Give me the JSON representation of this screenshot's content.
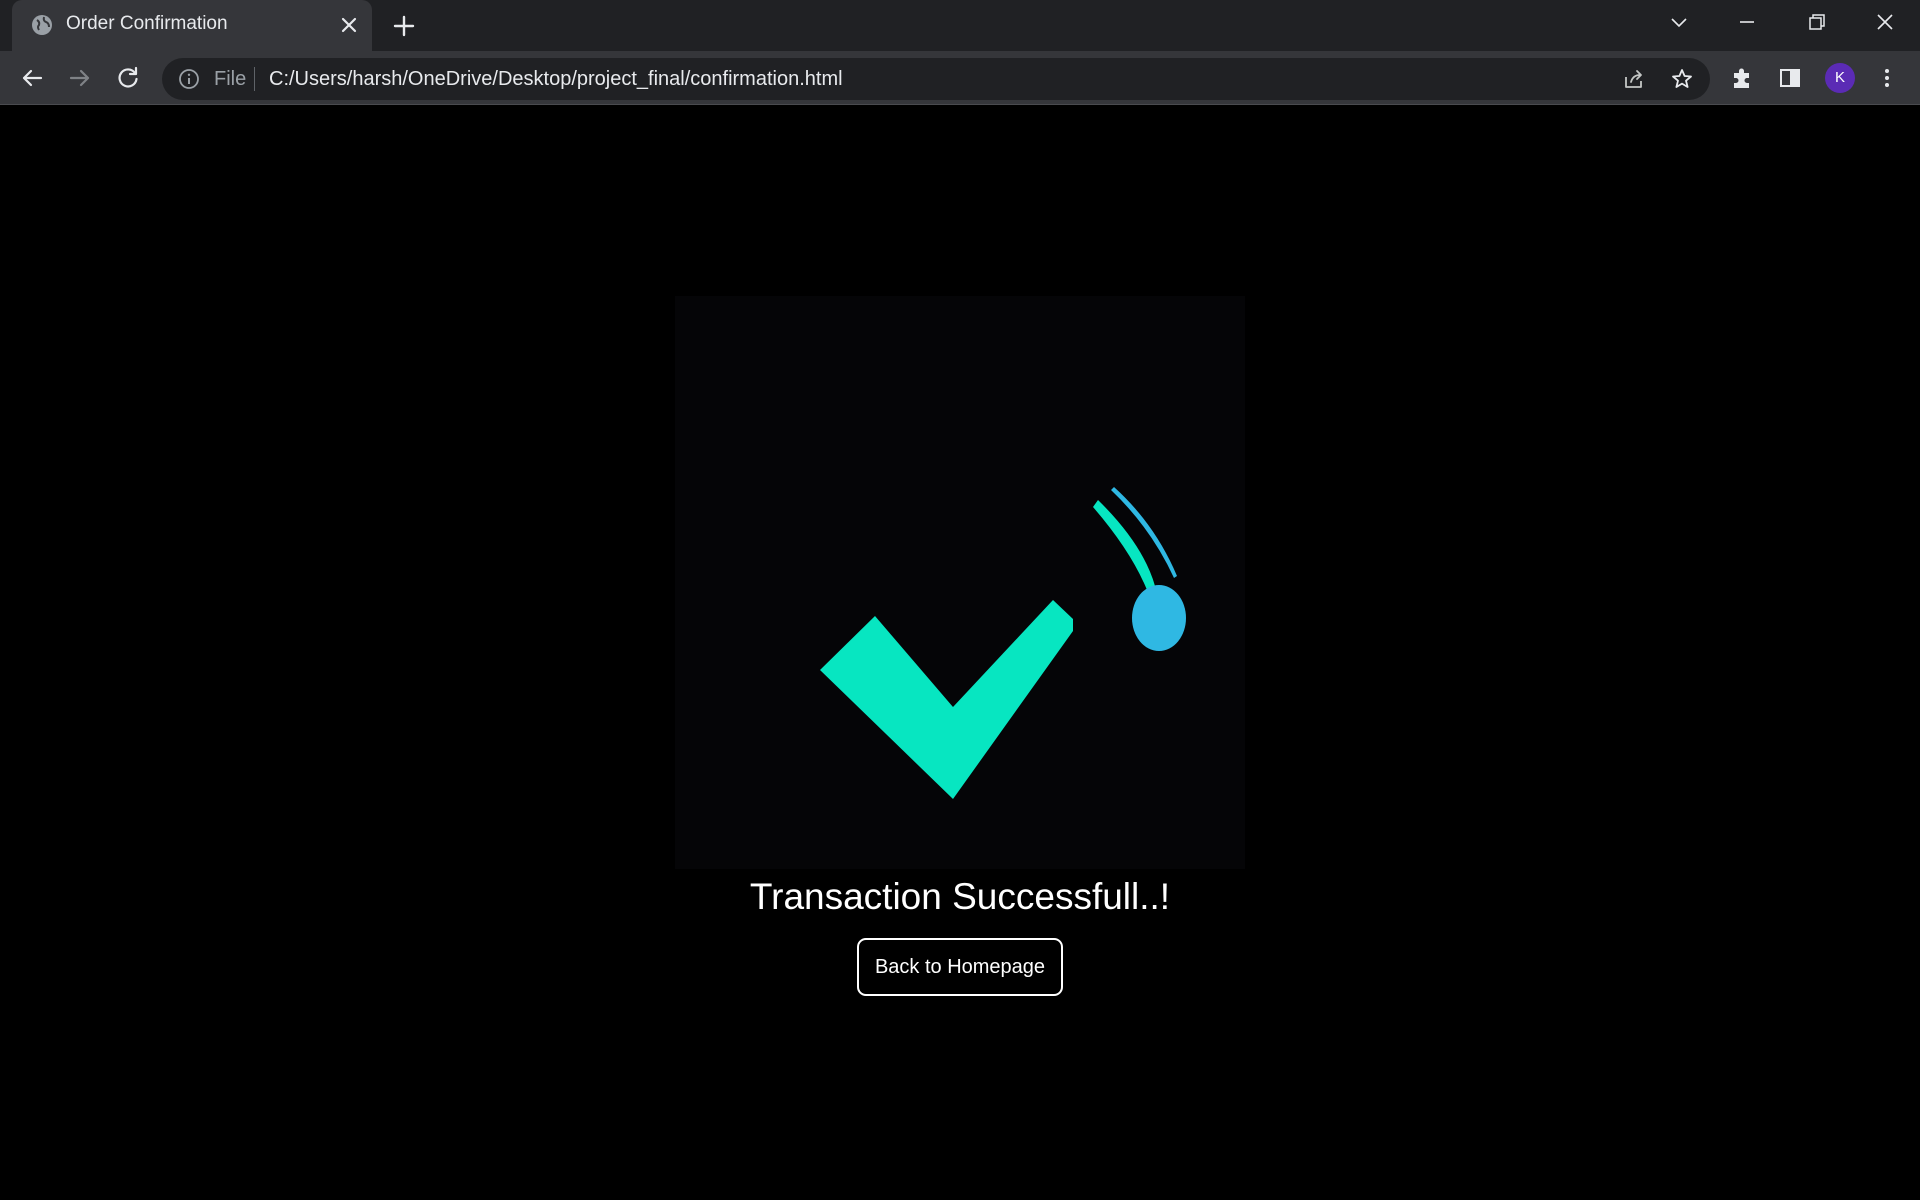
{
  "browser": {
    "tab": {
      "title": "Order Confirmation"
    },
    "address_bar": {
      "scheme_label": "File",
      "url": "C:/Users/harsh/OneDrive/Desktop/project_final/confirmation.html"
    },
    "profile_initial": "K",
    "profile_color": "#5b2bb5"
  },
  "page": {
    "status_title": "Transaction Successfull..!",
    "home_button_label": "Back to Homepage",
    "colors": {
      "checkmark": "#07e6c1",
      "dot": "#2fb8e3",
      "background": "#000000"
    }
  },
  "icons": {
    "tab_favicon": "globe-icon",
    "tab_close": "close-icon",
    "new_tab": "plus-icon",
    "back": "arrow-left-icon",
    "forward": "arrow-right-icon",
    "reload": "reload-icon",
    "site_info": "info-icon",
    "share": "share-icon",
    "bookmark": "star-icon",
    "extensions": "puzzle-icon",
    "side_panel": "side-panel-icon",
    "menu": "kebab-menu-icon"
  }
}
